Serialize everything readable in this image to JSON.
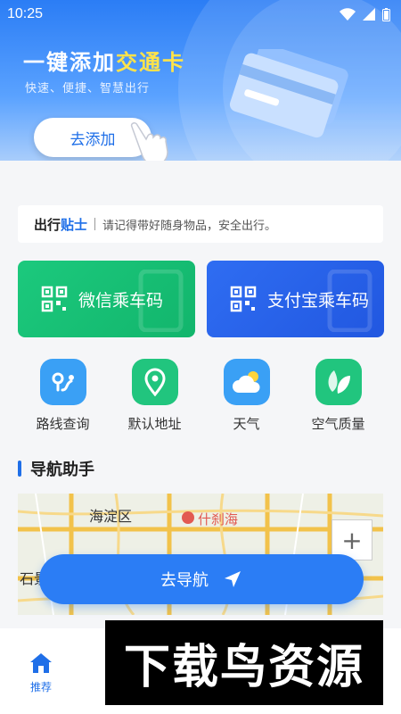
{
  "status_bar": {
    "time": "10:25"
  },
  "banner": {
    "title_prefix": "一键添加",
    "title_highlight": "交通卡",
    "subtitle": "快速、便捷、智慧出行",
    "add_button": "去添加"
  },
  "tip": {
    "title_part1": "出行",
    "title_part2": "贴士",
    "text": "请记得带好随身物品，安全出行。"
  },
  "ride_codes": [
    {
      "label": "微信乘车码",
      "color": "#1cc97d"
    },
    {
      "label": "支付宝乘车码",
      "color": "#2f6df2"
    }
  ],
  "quick_actions": [
    {
      "label": "路线查询",
      "icon": "route-icon",
      "color": "#3aa0f5"
    },
    {
      "label": "默认地址",
      "icon": "location-pin-icon",
      "color": "#21c57e"
    },
    {
      "label": "天气",
      "icon": "weather-icon",
      "color": "#3aa0f5"
    },
    {
      "label": "空气质量",
      "icon": "leaf-icon",
      "color": "#21c57e"
    }
  ],
  "navigation": {
    "section_title": "导航助手",
    "map_labels": [
      "海淀区",
      "什刹海",
      "石景"
    ],
    "zoom_in": "+",
    "go_button": "去导航"
  },
  "tabbar": {
    "home_label": "推荐"
  },
  "watermark": "下载鸟资源",
  "colors": {
    "primary": "#2b7df5",
    "green": "#1cc97d",
    "highlight": "#ffe34a"
  }
}
